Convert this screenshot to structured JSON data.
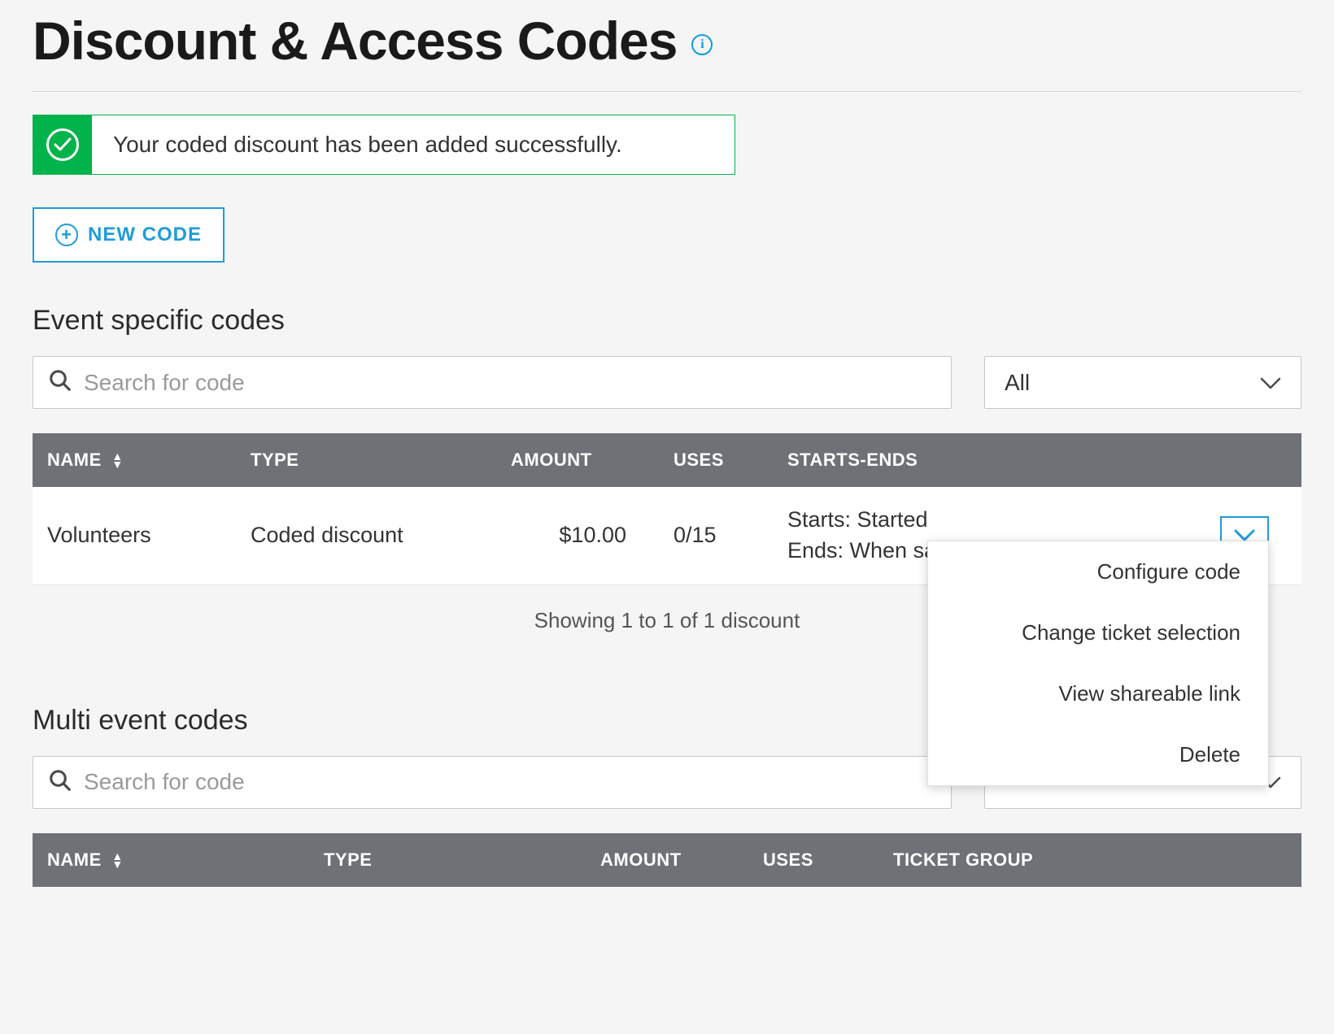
{
  "header": {
    "title": "Discount & Access Codes"
  },
  "alert": {
    "message": "Your coded discount has been added successfully."
  },
  "actions": {
    "new_code_label": "NEW CODE"
  },
  "event_codes": {
    "heading": "Event specific codes",
    "search_placeholder": "Search for code",
    "filter_selected": "All",
    "columns": {
      "name": "NAME",
      "type": "TYPE",
      "amount": "AMOUNT",
      "uses": "USES",
      "starts_ends": "STARTS-ENDS"
    },
    "rows": [
      {
        "name": "Volunteers",
        "type": "Coded discount",
        "amount": "$10.00",
        "uses": "0/15",
        "starts": "Starts: Started",
        "ends": "Ends: When sales end"
      }
    ],
    "pagination_text": "Showing 1 to 1 of 1 discount"
  },
  "row_menu": {
    "items": [
      "Configure code",
      "Change ticket selection",
      "View shareable link",
      "Delete"
    ]
  },
  "multi_codes": {
    "heading": "Multi event codes",
    "search_placeholder": "Search for code",
    "columns": {
      "name": "NAME",
      "type": "TYPE",
      "amount": "AMOUNT",
      "uses": "USES",
      "ticket_group": "TICKET GROUP"
    }
  }
}
